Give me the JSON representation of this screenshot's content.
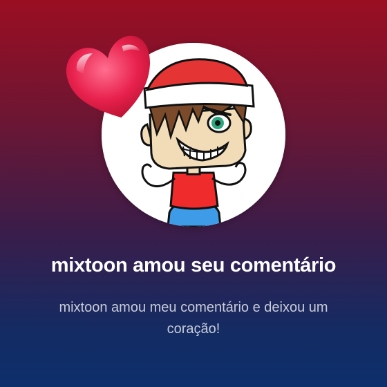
{
  "notification": {
    "title": "mixtoon amou seu comentário",
    "message": "mixtoon amou meu comentário e deixou um coração!"
  },
  "icons": {
    "avatar": "cartoon-boy-santa-hat-avatar",
    "reaction": "heart-icon"
  },
  "colors": {
    "background_top": "#9a0e22",
    "background_bottom": "#0d2f6c",
    "heart": "#e8214d",
    "title_text": "#ffffff",
    "message_text": "#c9ccd8"
  }
}
